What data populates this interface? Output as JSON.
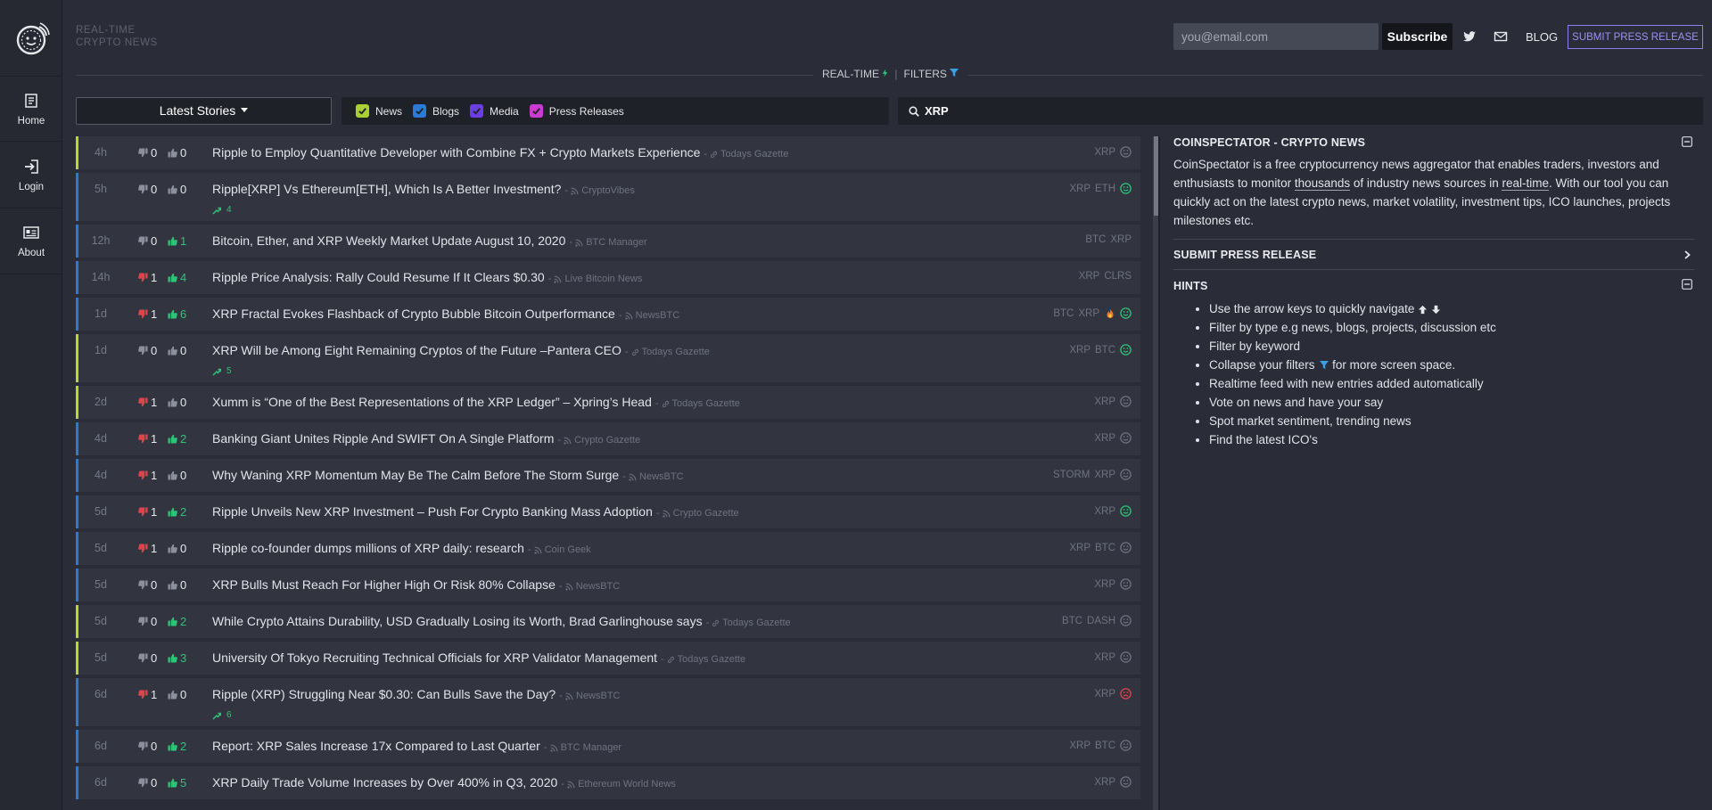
{
  "brand": {
    "line1": "REAL-TIME",
    "line2": "CRYPTO NEWS"
  },
  "nav": [
    {
      "label": "Home",
      "icon": "home-icon"
    },
    {
      "label": "Login",
      "icon": "login-icon"
    },
    {
      "label": "About",
      "icon": "about-icon"
    }
  ],
  "header": {
    "email_placeholder": "you@email.com",
    "subscribe": "Subscribe",
    "blog": "BLOG",
    "press": "SUBMIT PRESS RELEASE"
  },
  "toolbar": {
    "realtime": "REAL-TIME",
    "filters": "FILTERS",
    "sort": "Latest Stories",
    "search_value": "XRP"
  },
  "types": [
    {
      "label": "News",
      "color": "#a9cf33"
    },
    {
      "label": "Blogs",
      "color": "#2b7ad8"
    },
    {
      "label": "Media",
      "color": "#6b3ee3"
    },
    {
      "label": "Press Releases",
      "color": "#c93bd2"
    }
  ],
  "colors": {
    "accent": "#8f7df1",
    "news_border": "#2b7ad8",
    "press_border": "#bcd631",
    "positive": "#2ec478",
    "negative": "#e0434e",
    "fire": "#f07b26"
  },
  "stories": [
    {
      "age": "4h",
      "down": "0",
      "up": "0",
      "title": "Ripple to Employ Quantitative Developer with Combine FX + Crypto Markets Experience",
      "source": "Todays Gazette",
      "src_icon": "link-icon",
      "tags": [
        "XRP"
      ],
      "sentiment": "neutral",
      "type": "press",
      "down_color": "grey",
      "up_color": "grey"
    },
    {
      "age": "5h",
      "down": "0",
      "up": "0",
      "title": "Ripple[XRP] Vs Ethereum[ETH], Which Is A Better Investment?",
      "source": "CryptoVibes",
      "src_icon": "rss-icon",
      "tags": [
        "XRP",
        "ETH"
      ],
      "sentiment": "positive",
      "type": "news",
      "trend": "4",
      "down_color": "grey",
      "up_color": "grey"
    },
    {
      "age": "12h",
      "down": "0",
      "up": "1",
      "title": "Bitcoin, Ether, and XRP Weekly Market Update August 10, 2020",
      "source": "BTC Manager",
      "src_icon": "rss-icon",
      "tags": [
        "BTC",
        "XRP"
      ],
      "sentiment": "none",
      "type": "news",
      "down_color": "grey",
      "up_color": "green"
    },
    {
      "age": "14h",
      "down": "1",
      "up": "4",
      "title": "Ripple Price Analysis: Rally Could Resume If It Clears $0.30",
      "source": "Live Bitcoin News",
      "src_icon": "rss-icon",
      "tags": [
        "XRP",
        "CLRS"
      ],
      "sentiment": "none",
      "type": "news",
      "down_color": "red",
      "up_color": "green"
    },
    {
      "age": "1d",
      "down": "1",
      "up": "6",
      "title": "XRP Fractal Evokes Flashback of Crypto Bubble Bitcoin Outperformance",
      "source": "NewsBTC",
      "src_icon": "rss-icon",
      "tags": [
        "BTC",
        "XRP"
      ],
      "sentiment": "positive",
      "fire": true,
      "type": "news",
      "down_color": "red",
      "up_color": "green"
    },
    {
      "age": "1d",
      "down": "0",
      "up": "0",
      "title": "XRP Will be Among Eight Remaining Cryptos of the Future –Pantera CEO",
      "source": "Todays Gazette",
      "src_icon": "link-icon",
      "tags": [
        "XRP",
        "BTC"
      ],
      "sentiment": "positive",
      "type": "press",
      "trend": "5",
      "down_color": "grey",
      "up_color": "grey"
    },
    {
      "age": "2d",
      "down": "1",
      "up": "0",
      "title": "Xumm is “One of the Best Representations of the XRP Ledger” – Xpring’s Head",
      "source": "Todays Gazette",
      "src_icon": "link-icon",
      "tags": [
        "XRP"
      ],
      "sentiment": "neutral",
      "type": "press",
      "down_color": "red",
      "up_color": "grey"
    },
    {
      "age": "4d",
      "down": "1",
      "up": "2",
      "title": "Banking Giant Unites Ripple And SWIFT On A Single Platform",
      "source": "Crypto Gazette",
      "src_icon": "rss-icon",
      "tags": [
        "XRP"
      ],
      "sentiment": "neutral",
      "type": "news",
      "down_color": "red",
      "up_color": "green"
    },
    {
      "age": "4d",
      "down": "1",
      "up": "0",
      "title": "Why Waning XRP Momentum May Be The Calm Before The Storm Surge",
      "source": "NewsBTC",
      "src_icon": "rss-icon",
      "tags": [
        "STORM",
        "XRP"
      ],
      "sentiment": "neutral",
      "type": "news",
      "down_color": "red",
      "up_color": "grey"
    },
    {
      "age": "5d",
      "down": "1",
      "up": "2",
      "title": "Ripple Unveils New XRP Investment – Push For Crypto Banking Mass Adoption",
      "source": "Crypto Gazette",
      "src_icon": "rss-icon",
      "tags": [
        "XRP"
      ],
      "sentiment": "positive",
      "type": "news",
      "down_color": "red",
      "up_color": "green"
    },
    {
      "age": "5d",
      "down": "1",
      "up": "0",
      "title": "Ripple co-founder dumps millions of XRP daily: research",
      "source": "Coin Geek",
      "src_icon": "rss-icon",
      "tags": [
        "XRP",
        "BTC"
      ],
      "sentiment": "neutral",
      "type": "news",
      "down_color": "red",
      "up_color": "grey"
    },
    {
      "age": "5d",
      "down": "0",
      "up": "0",
      "title": "XRP Bulls Must Reach For Higher High Or Risk 80% Collapse",
      "source": "NewsBTC",
      "src_icon": "rss-icon",
      "tags": [
        "XRP"
      ],
      "sentiment": "neutral",
      "type": "news",
      "down_color": "grey",
      "up_color": "grey"
    },
    {
      "age": "5d",
      "down": "0",
      "up": "2",
      "title": "While Crypto Attains Durability, USD Gradually Losing its Worth, Brad Garlinghouse says",
      "source": "Todays Gazette",
      "src_icon": "link-icon",
      "tags": [
        "BTC",
        "DASH"
      ],
      "sentiment": "neutral",
      "type": "press",
      "down_color": "grey",
      "up_color": "green"
    },
    {
      "age": "5d",
      "down": "0",
      "up": "3",
      "title": "University Of Tokyo Recruiting Technical Officials for XRP Validator Management",
      "source": "Todays Gazette",
      "src_icon": "link-icon",
      "tags": [
        "XRP"
      ],
      "sentiment": "neutral",
      "type": "press",
      "down_color": "grey",
      "up_color": "green"
    },
    {
      "age": "6d",
      "down": "1",
      "up": "0",
      "title": "Ripple (XRP) Struggling Near $0.30: Can Bulls Save the Day?",
      "source": "NewsBTC",
      "src_icon": "rss-icon",
      "tags": [
        "XRP"
      ],
      "sentiment": "negative",
      "type": "news",
      "trend": "6",
      "down_color": "red",
      "up_color": "grey"
    },
    {
      "age": "6d",
      "down": "0",
      "up": "2",
      "title": "Report: XRP Sales Increase 17x Compared to Last Quarter",
      "source": "BTC Manager",
      "src_icon": "rss-icon",
      "tags": [
        "XRP",
        "BTC"
      ],
      "sentiment": "neutral",
      "type": "news",
      "down_color": "grey",
      "up_color": "green"
    },
    {
      "age": "6d",
      "down": "0",
      "up": "5",
      "title": "XRP Daily Trade Volume Increases by Over 400% in Q3, 2020",
      "source": "Ethereum World News",
      "src_icon": "rss-icon",
      "tags": [
        "XRP"
      ],
      "sentiment": "neutral",
      "type": "news",
      "down_color": "grey",
      "up_color": "green"
    }
  ],
  "panel": {
    "about_title": "COINSPECTATOR - CRYPTO NEWS",
    "about_p1": "CoinSpectator is a free cryptocurrency news aggregator that enables traders, investors and enthusiasts to monitor ",
    "about_u1": "thousands",
    "about_p2": " of industry news sources in ",
    "about_u2": "real-time",
    "about_p3": ". With our tool you can quickly act on the latest crypto news, market volatility, investment tips, ICO launches, projects milestones etc.",
    "press_title": "SUBMIT PRESS RELEASE",
    "hints_title": "HINTS",
    "hints": [
      "Use the arrow keys to quickly navigate",
      "Filter by type e.g news, blogs, projects, discussion etc",
      "Filter by keyword",
      "Collapse your filters",
      "Realtime feed with new entries added automatically",
      "Vote on news and have your say",
      "Spot market sentiment, trending news",
      "Find the latest ICO's"
    ],
    "hint_collapse_suffix": "for more screen space."
  }
}
